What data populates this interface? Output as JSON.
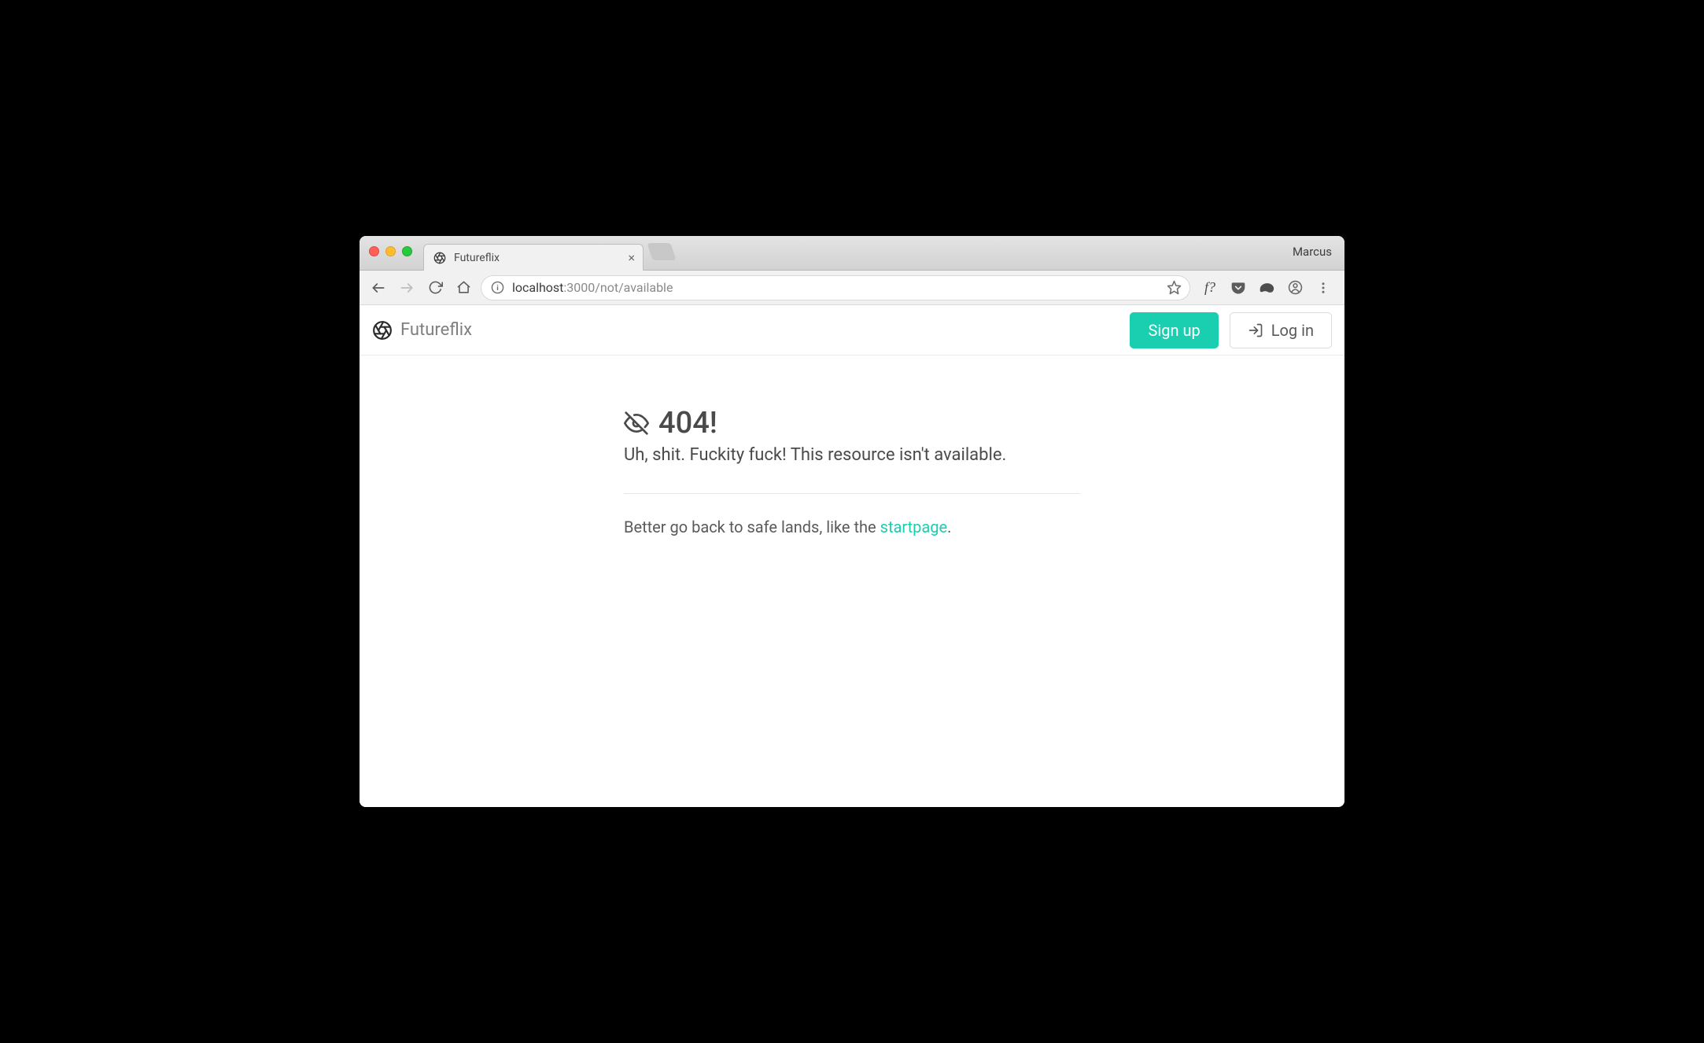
{
  "browser": {
    "tab_title": "Futureflix",
    "profile_name": "Marcus",
    "url_host": "localhost",
    "url_rest": ":3000/not/available",
    "ext_fscript": "f?"
  },
  "navbar": {
    "brand": "Futureflix",
    "signup_label": "Sign up",
    "login_label": "Log in"
  },
  "error": {
    "title": "404!",
    "subtitle": "Uh, shit. Fuckity fuck! This resource isn't available.",
    "hint_prefix": "Better go back to safe lands, like the ",
    "hint_link": "startpage",
    "hint_suffix": "."
  },
  "colors": {
    "accent": "#19cfb0"
  }
}
